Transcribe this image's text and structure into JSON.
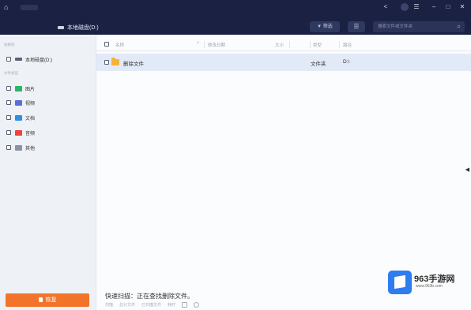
{
  "titlebar": {
    "app_name": "",
    "drive_label": "本地磁盘(D:)",
    "filter_label": "筛选",
    "search_placeholder": "搜索文件或文件夹"
  },
  "sidebar": {
    "section_path": "按路径",
    "section_type": "文件类型",
    "drive_item": {
      "label": "本地磁盘(D:)",
      "count": ""
    },
    "types": [
      {
        "label": "图片",
        "count": "",
        "color": "#2db36a"
      },
      {
        "label": "视频",
        "count": "",
        "color": "#5d6dd8"
      },
      {
        "label": "文档",
        "count": "",
        "color": "#2d8fe6"
      },
      {
        "label": "音频",
        "count": "",
        "color": "#e8473e"
      },
      {
        "label": "其他",
        "count": "",
        "color": "#8a93a5"
      }
    ],
    "recover_label": "恢复"
  },
  "table": {
    "columns": [
      "名称",
      "修改日期",
      "大小",
      "类型",
      "路径"
    ],
    "rows": [
      {
        "name": "删除文件",
        "modified": "",
        "size": "",
        "type": "文件夹",
        "path": "D:\\"
      }
    ]
  },
  "status": {
    "scan_text": "快速扫描：正在查找删除文件。",
    "details": [
      "扫描",
      "总计文件",
      "已扫描文件",
      "耗时"
    ]
  },
  "watermark": {
    "title": "963手游网",
    "url": "www.963b.com"
  },
  "colors": {
    "titlebar": "#1a2142",
    "recover_button": "#f2742b",
    "selected_row": "#e3eaf7"
  }
}
